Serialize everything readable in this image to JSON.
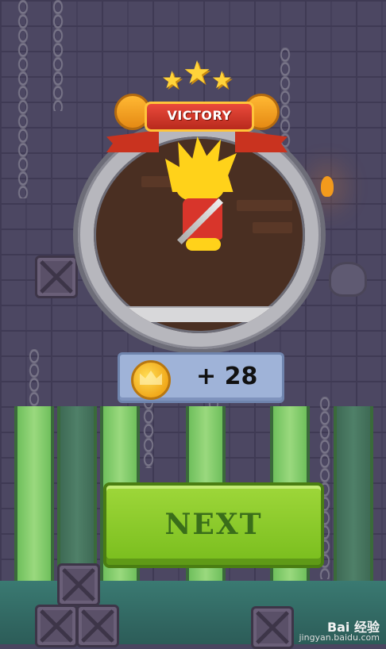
{
  "game": {
    "banner_title": "VICTORY",
    "stars_earned": 3,
    "reward": {
      "amount_text": "+ 28",
      "currency_icon": "crown-coin-icon"
    },
    "next_button_label": "NEXT"
  },
  "watermark": {
    "brand": "Bai 经验",
    "url": "jingyan.baidu.com"
  },
  "colors": {
    "next_button": "#8ccd2a",
    "banner_red": "#d33a2a",
    "reward_panel": "#9fb3d8",
    "coin_gold": "#f1a91b",
    "portal_ring": "#b7b7bd",
    "background": "#4a4560"
  }
}
